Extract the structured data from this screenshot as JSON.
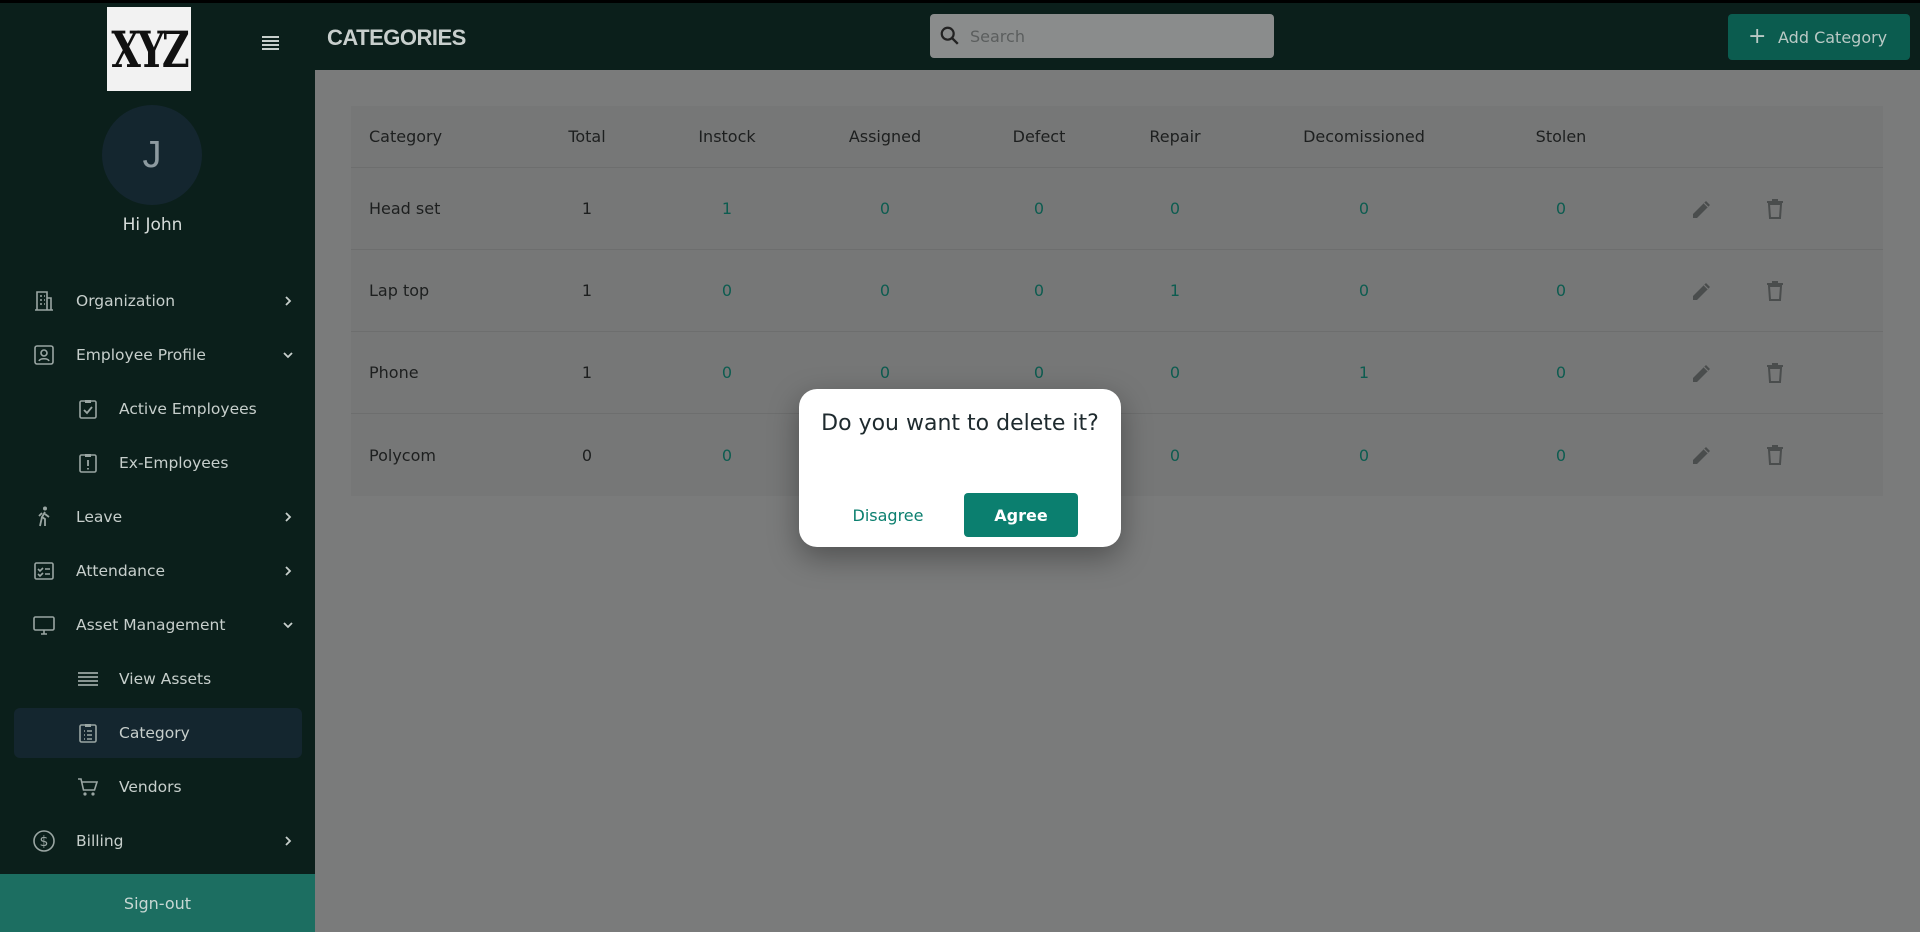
{
  "app": {
    "logo_text": "XYZ",
    "avatar_letter": "J",
    "greeting": "Hi John"
  },
  "sidebar": {
    "items": [
      {
        "label": "Organization",
        "icon": "building-icon",
        "expandable": "collapsed"
      },
      {
        "label": "Employee Profile",
        "icon": "id-card-icon",
        "expandable": "expanded"
      },
      {
        "label": "Active Employees",
        "icon": "clipboard-check-icon",
        "sub": true
      },
      {
        "label": "Ex-Employees",
        "icon": "clipboard-alert-icon",
        "sub": true
      },
      {
        "label": "Leave",
        "icon": "walking-person-icon",
        "expandable": "collapsed"
      },
      {
        "label": "Attendance",
        "icon": "checklist-icon",
        "expandable": "collapsed"
      },
      {
        "label": "Asset Management",
        "icon": "monitor-icon",
        "expandable": "expanded"
      },
      {
        "label": "View Assets",
        "icon": "list-icon",
        "sub": true
      },
      {
        "label": "Category",
        "icon": "clipboard-list-icon",
        "sub": true,
        "active": true
      },
      {
        "label": "Vendors",
        "icon": "cart-icon",
        "sub": true
      },
      {
        "label": "Billing",
        "icon": "dollar-circle-icon",
        "expandable": "collapsed"
      }
    ],
    "signout_label": "Sign-out"
  },
  "header": {
    "title": "CATEGORIES",
    "search_placeholder": "Search",
    "add_button_label": "Add Category"
  },
  "table": {
    "columns": [
      "Category",
      "Total",
      "Instock",
      "Assigned",
      "Defect",
      "Repair",
      "Decomissioned",
      "Stolen"
    ],
    "rows": [
      {
        "category": "Head set",
        "total": "1",
        "instock": "1",
        "assigned": "0",
        "defect": "0",
        "repair": "0",
        "decomissioned": "0",
        "stolen": "0"
      },
      {
        "category": "Lap top",
        "total": "1",
        "instock": "0",
        "assigned": "0",
        "defect": "0",
        "repair": "1",
        "decomissioned": "0",
        "stolen": "0"
      },
      {
        "category": "Phone",
        "total": "1",
        "instock": "0",
        "assigned": "0",
        "defect": "0",
        "repair": "0",
        "decomissioned": "1",
        "stolen": "0"
      },
      {
        "category": "Polycom",
        "total": "0",
        "instock": "0",
        "assigned": "",
        "defect": "",
        "repair": "0",
        "decomissioned": "0",
        "stolen": "0"
      }
    ]
  },
  "dialog": {
    "title": "Do you want to delete it?",
    "disagree_label": "Disagree",
    "agree_label": "Agree"
  },
  "colors": {
    "sidebar_bg": "#0b1f1b",
    "accent": "#0b7f6f",
    "signout_bg": "#1c6e61",
    "overlay": "#7a7b7b"
  }
}
